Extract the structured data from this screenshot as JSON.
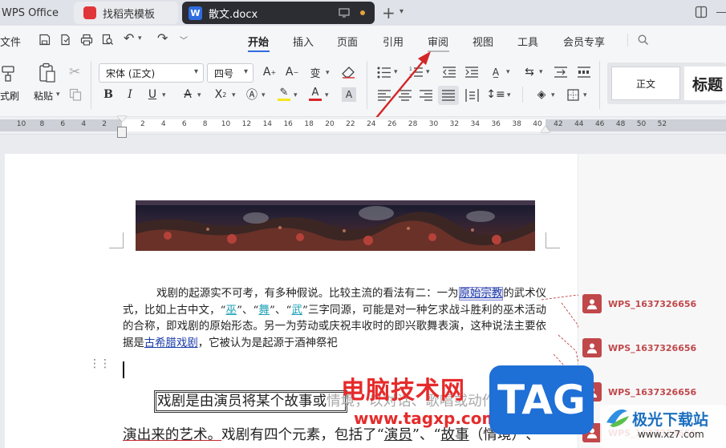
{
  "tabs": {
    "home": {
      "label": "WPS Office"
    },
    "template": {
      "label": "找稻壳模板"
    },
    "doc": {
      "label": "散文.docx"
    }
  },
  "menubar": {
    "file": "文件",
    "items": [
      "开始",
      "插入",
      "页面",
      "引用",
      "审阅",
      "视图",
      "工具",
      "会员专享"
    ]
  },
  "ribbon": {
    "format_painter": "格式刷",
    "paste": "粘贴",
    "font_name": "宋体 (正文)",
    "font_size": "四号",
    "styles": {
      "normal": "正文",
      "heading": "标题"
    }
  },
  "ruler": {
    "left_ticks": [
      "10",
      "8",
      "6",
      "4",
      "2"
    ],
    "right_ticks": [
      "2",
      "4",
      "6",
      "8",
      "10",
      "12",
      "14",
      "16",
      "18",
      "20",
      "22",
      "24",
      "26",
      "28",
      "30",
      "32",
      "34",
      "36",
      "38",
      "40",
      "42",
      "44",
      "46",
      "48",
      "50",
      "52"
    ]
  },
  "document": {
    "p1": {
      "a": "戏剧的起源实不可考，有多种假说。比较主流的看法有二：一为",
      "link1": "原始宗教",
      "b": "的武术仪式，比如上古中文，“",
      "w1": "巫",
      "c": "”、“",
      "w2": "舞",
      "d": "”、“",
      "w3": "武",
      "e": "”三字同源，可能是对一种乞求战斗胜利的巫术活动的合称，即戏剧的原始形态。另一为劳动或庆祝丰收时的即兴歌舞表演，这种说法主要依据是",
      "link2": "古希腊戏剧",
      "f": "，它被认为是起源于酒神祭祀"
    },
    "p2": {
      "boxed": "戏剧是由演员将某个故事或",
      "faded": "情境，以对话、歌唱或动作方式",
      "u": "演出来的艺术。",
      "rest": "戏剧有四个元素，包括了“",
      "l1": "演员",
      "mid": "”、“",
      "l2": "故事",
      "end": "（情境）”、"
    }
  },
  "comments": {
    "user": "WPS_1637326656"
  },
  "watermark": {
    "title": "电脑技术网",
    "url": "www.tagxp.com",
    "tag": "TAG",
    "site": "极光下载站",
    "site_url": "www.xz7.com"
  },
  "colors": {
    "accent": "#c0484a",
    "active_tab": "#2b2d33",
    "brand": "#1b5fc7"
  }
}
